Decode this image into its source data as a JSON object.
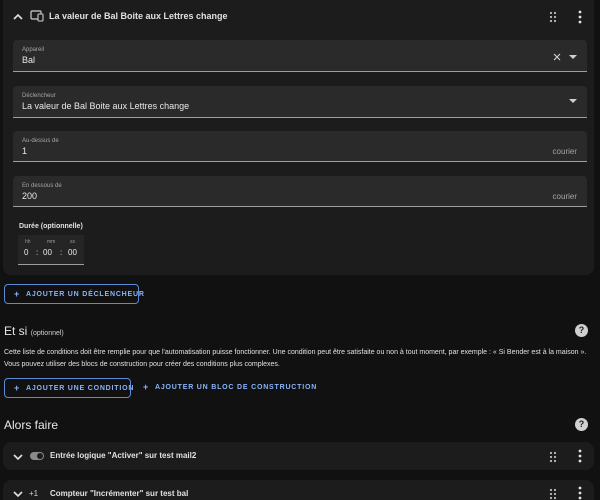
{
  "trigger_card": {
    "title": "La valeur de Bal Boite aux Lettres change",
    "fields": {
      "device": {
        "label": "Appareil",
        "value": "Bal"
      },
      "trigger": {
        "label": "Déclencheur",
        "value": "La valeur de Bal Boite aux Lettres change"
      },
      "above": {
        "label": "Au-dessus de",
        "value": "1",
        "suffix": "courier"
      },
      "below": {
        "label": "En dessous de",
        "value": "200",
        "suffix": "courier"
      }
    },
    "duration": {
      "title": "Durée (optionnelle)",
      "hh_label": "hh",
      "mm_label": "mm",
      "ss_label": "ss",
      "hh": "0",
      "sep1": ":",
      "mm": "00",
      "sep2": ":",
      "ss": "00"
    }
  },
  "add_trigger_button": "AJOUTER UN DÉCLENCHEUR",
  "plus_glyph": "+",
  "conditions": {
    "title": "Et si",
    "subtitle": "(optionnel)",
    "help": "?",
    "description": "Cette liste de conditions doit être remplie pour que l'automatisation puisse fonctionner. Une condition peut être satisfaite ou non à tout moment, par exemple : « Si Bender est à la maison ». Vous pouvez utiliser des blocs de construction pour créer des conditions plus complexes.",
    "add_condition_button": "AJOUTER UNE CONDITION",
    "add_block_button": "AJOUTER UN BLOC DE CONSTRUCTION"
  },
  "actions": {
    "title": "Alors faire",
    "help": "?",
    "items": [
      {
        "title": "Entrée logique \"Activer\" sur test mail2",
        "icon": "toggle-switch-icon"
      },
      {
        "prefix": "+1",
        "title": "Compteur \"Incrémenter\" sur test bal",
        "icon": "counter-icon"
      }
    ]
  },
  "colors": {
    "accent": "#8ab4f8",
    "card": "#1c1c1c",
    "field": "#2a2a2a",
    "background": "#111111"
  }
}
